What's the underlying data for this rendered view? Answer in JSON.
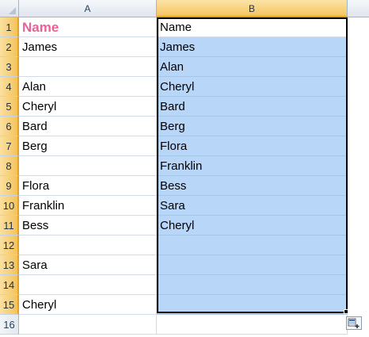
{
  "columns": [
    "A",
    "B"
  ],
  "rows": [
    "1",
    "2",
    "3",
    "4",
    "5",
    "6",
    "7",
    "8",
    "9",
    "10",
    "11",
    "12",
    "13",
    "14",
    "15",
    "16"
  ],
  "colA": [
    "Name",
    "James",
    "",
    "Alan",
    "Cheryl",
    "Bard",
    "Berg",
    "",
    "Flora",
    "Franklin",
    "Bess",
    "",
    "Sara",
    "",
    "Cheryl",
    ""
  ],
  "colB": [
    "Name",
    "James",
    "Alan",
    "Cheryl",
    "Bard",
    "Berg",
    "Flora",
    "Franklin",
    "Bess",
    "Sara",
    "Cheryl",
    "",
    "",
    "",
    "",
    ""
  ],
  "colors": {
    "header_title": "#ec5f97",
    "selection_fill": "#b8d6f8",
    "selected_header": "#f4c55f"
  },
  "icons": {
    "paste_options": "paste-options-icon"
  }
}
